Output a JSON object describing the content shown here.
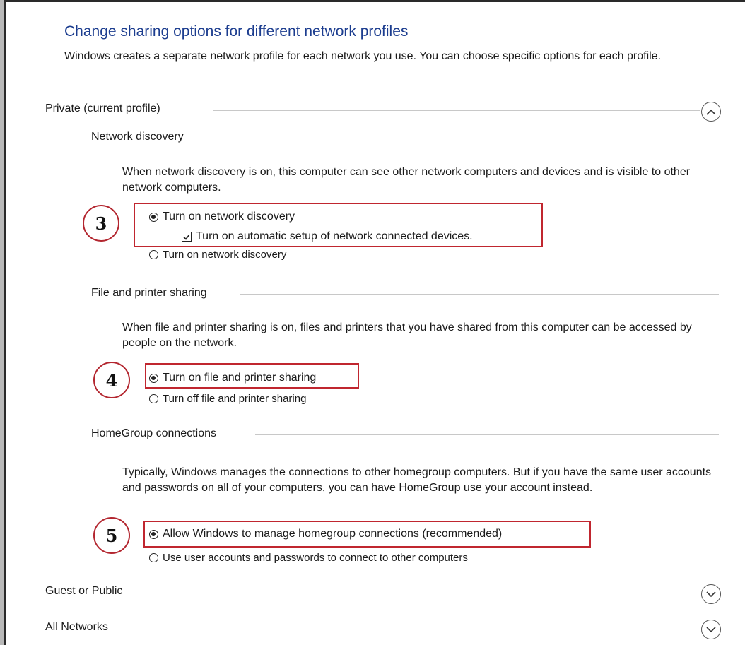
{
  "header": {
    "title": "Change sharing options for different network profiles",
    "description": "Windows creates a separate network profile for each network you use. You can choose specific options for each profile."
  },
  "profiles": {
    "private": {
      "label": "Private (current profile)",
      "expanded": true
    },
    "guest": {
      "label": "Guest or Public",
      "expanded": false
    },
    "all": {
      "label": "All Networks",
      "expanded": false
    }
  },
  "network_discovery": {
    "heading": "Network discovery",
    "description": "When network discovery is on, this computer can see other network computers and devices and is visible to other network computers.",
    "option_on": "Turn on network discovery",
    "option_auto": "Turn on automatic setup of network connected devices.",
    "option_off": "Turn on network discovery",
    "selected": "on",
    "auto_checked": true
  },
  "file_sharing": {
    "heading": "File and printer sharing",
    "description": "When file and printer sharing is on, files and printers that you have shared from this computer can be accessed by people on the network.",
    "option_on": "Turn on file and printer sharing",
    "option_off": "Turn off file and printer sharing",
    "selected": "on"
  },
  "homegroup": {
    "heading": "HomeGroup connections",
    "description": "Typically, Windows manages the connections to other homegroup computers. But if you have the same user accounts and passwords on all of your computers, you can have HomeGroup use your account instead.",
    "option_windows": "Allow Windows to manage homegroup connections (recommended)",
    "option_user": "Use user accounts and passwords to connect to other computers",
    "selected": "windows"
  },
  "callouts": [
    "3",
    "4",
    "5"
  ],
  "colors": {
    "title": "#1c3d8f",
    "highlight": "#c0262f"
  },
  "icons": {
    "expanded": "chevron-up-icon",
    "collapsed": "chevron-down-icon"
  }
}
